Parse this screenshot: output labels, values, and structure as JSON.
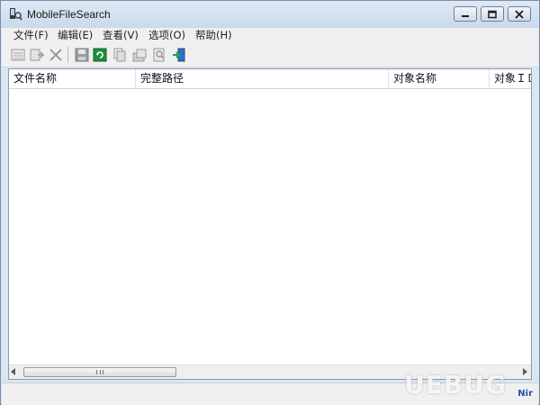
{
  "window": {
    "title": "MobileFileSearch"
  },
  "menu": [
    {
      "label": "文件(F)"
    },
    {
      "label": "编辑(E)"
    },
    {
      "label": "查看(V)"
    },
    {
      "label": "选项(O)"
    },
    {
      "label": "帮助(H)"
    }
  ],
  "toolbar": {
    "icons": [
      "properties-icon",
      "export-icon",
      "delete-icon",
      "save-icon",
      "refresh-icon",
      "copy-icon",
      "copy-folder-icon",
      "find-icon",
      "exit-icon"
    ]
  },
  "list": {
    "columns": [
      {
        "label": "文件名称"
      },
      {
        "label": "完整路径"
      },
      {
        "label": "对象名称"
      },
      {
        "label": "对象ＩＤ"
      }
    ],
    "rows": []
  },
  "status": {
    "corner_text": "Nir"
  },
  "watermark": "UEBUG"
}
